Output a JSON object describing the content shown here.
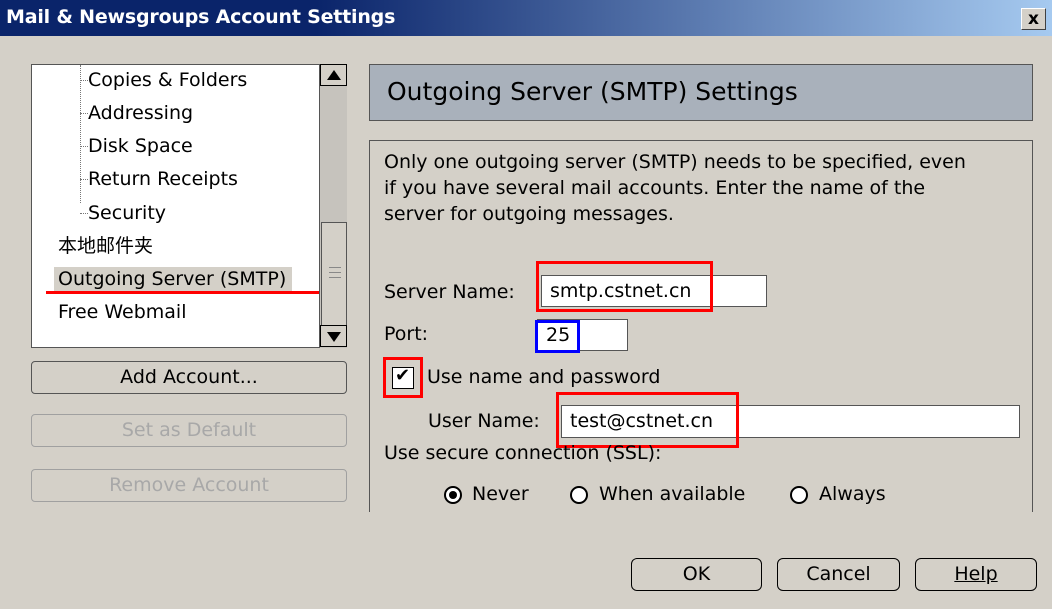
{
  "window": {
    "title": "Mail & Newsgroups Account Settings",
    "close_symbol": "x"
  },
  "tree": {
    "items": [
      {
        "label": "Copies & Folders",
        "level": 2
      },
      {
        "label": "Addressing",
        "level": 2
      },
      {
        "label": "Disk Space",
        "level": 2
      },
      {
        "label": "Return Receipts",
        "level": 2
      },
      {
        "label": "Security",
        "level": 2
      },
      {
        "label": "本地邮件夹",
        "level": 1
      },
      {
        "label": "Outgoing Server (SMTP)",
        "level": 1,
        "selected": true
      },
      {
        "label": "Free Webmail",
        "level": 1
      }
    ]
  },
  "side_buttons": {
    "add_account": "Add Account...",
    "set_default": "Set as Default",
    "remove_account": "Remove Account"
  },
  "panel": {
    "title": "Outgoing Server (SMTP) Settings",
    "description_lines": [
      "Only one outgoing server (SMTP) needs to be specified, even",
      "if you have several mail accounts. Enter the name of the",
      "server for outgoing messages."
    ]
  },
  "fields": {
    "server_name_label": "Server Name:",
    "server_name_value": "smtp.cstnet.cn",
    "port_label": "Port:",
    "port_value": "25",
    "use_name_password_label": "Use name and password",
    "use_name_password_checked": true,
    "user_name_label": "User Name:",
    "user_name_value": "test@cstnet.cn",
    "ssl_label": "Use secure connection (SSL):",
    "ssl_options": [
      "Never",
      "When available",
      "Always"
    ],
    "ssl_selected": "Never"
  },
  "footer": {
    "ok": "OK",
    "cancel": "Cancel",
    "help": "Help"
  },
  "colors": {
    "title_bar": "#0a246a",
    "highlight_red": "#ff0000",
    "highlight_blue": "#0000ff",
    "window_bg": "#d4d0c8",
    "header_panel": "#a9b1bb"
  },
  "icons": {
    "close": "close-icon",
    "scroll_up": "scroll-up-arrow-icon",
    "scroll_down": "scroll-down-arrow-icon",
    "checkbox": "checkmark-icon",
    "radio": "radio-dot-icon"
  }
}
